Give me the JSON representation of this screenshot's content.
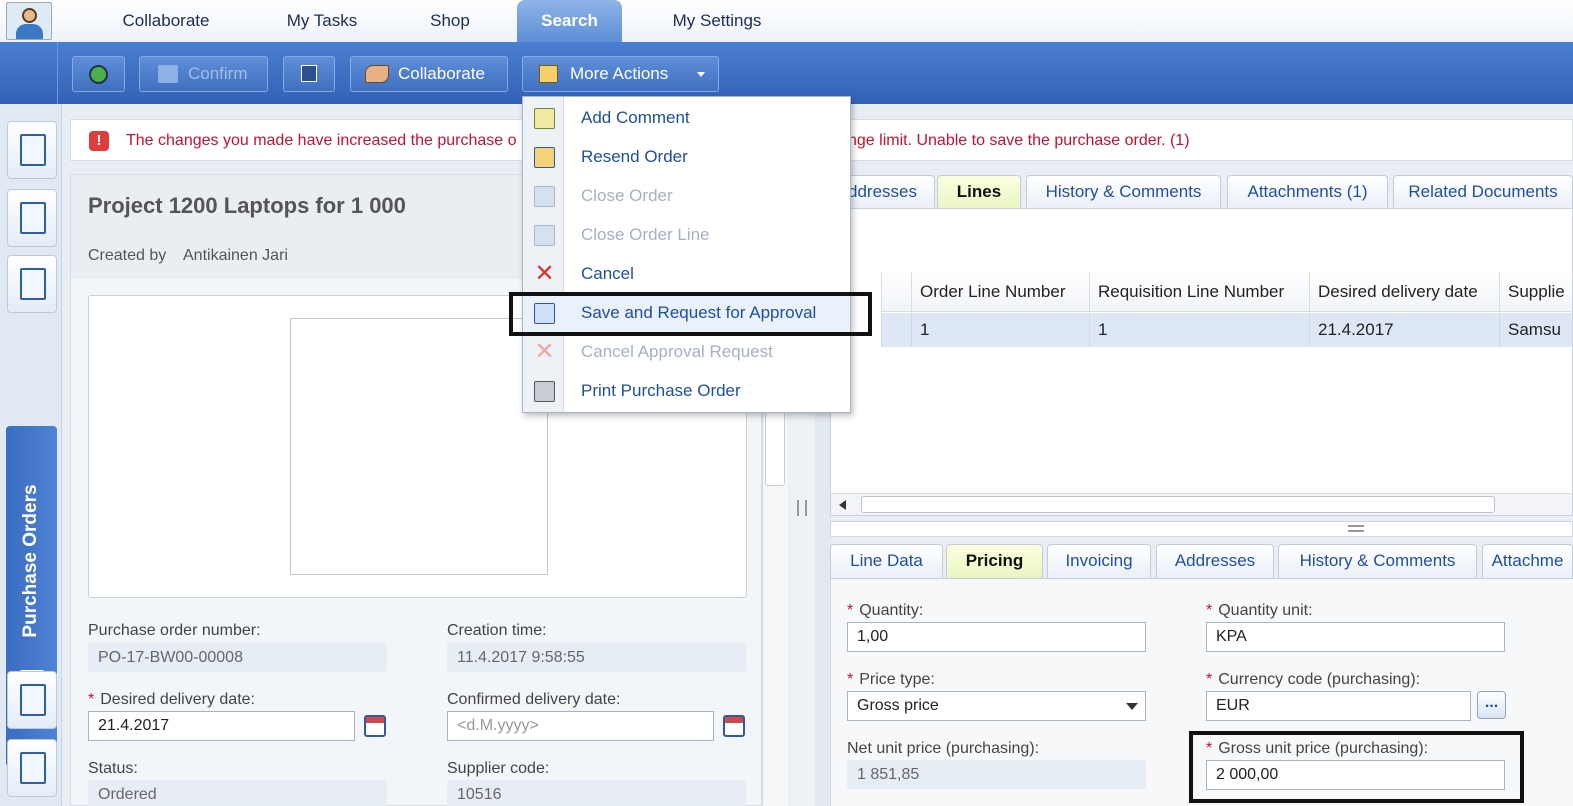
{
  "top_nav": {
    "tabs": [
      {
        "label": "Collaborate",
        "active": false
      },
      {
        "label": "My Tasks",
        "active": false
      },
      {
        "label": "Shop",
        "active": false
      },
      {
        "label": "Search",
        "active": true
      },
      {
        "label": "My Settings",
        "active": false
      }
    ]
  },
  "toolbar": {
    "confirm_label": "Confirm",
    "collaborate_label": "Collaborate",
    "more_actions_label": "More Actions"
  },
  "left_rail": {
    "purchase_orders_label": "Purchase Orders"
  },
  "error": {
    "text_left": "The changes you made have increased the purchase o",
    "text_right": "nge limit. Unable to save the purchase order. (1)"
  },
  "order": {
    "title": "Project 1200 Laptops for 1 000",
    "created_by_label": "Created by",
    "created_by_value": "Antikainen Jari",
    "fields": {
      "po_number_label": "Purchase order number:",
      "po_number_value": "PO-17-BW00-00008",
      "creation_time_label": "Creation time:",
      "creation_time_value": "11.4.2017 9:58:55",
      "desired_delivery_label": "Desired delivery date:",
      "desired_delivery_value": "21.4.2017",
      "confirmed_delivery_label": "Confirmed delivery date:",
      "confirmed_delivery_placeholder": "<d.M.yyyy>",
      "status_label": "Status:",
      "status_value": "Ordered",
      "supplier_code_label": "Supplier code:",
      "supplier_code_value": "10516"
    }
  },
  "detail_tabs": {
    "tabs": [
      {
        "label": "ddresses",
        "active": false
      },
      {
        "label": "Lines",
        "active": true
      },
      {
        "label": "History & Comments",
        "active": false
      },
      {
        "label": "Attachments (1)",
        "active": false
      },
      {
        "label": "Related Documents",
        "active": false
      }
    ]
  },
  "lines_grid": {
    "columns": [
      "Order Line Number",
      "Requisition Line Number",
      "Desired delivery date",
      "Supplie"
    ],
    "rows": [
      [
        "1",
        "1",
        "21.4.2017",
        "Samsu"
      ]
    ]
  },
  "line_tabs": {
    "tabs": [
      {
        "label": "Line Data",
        "active": false
      },
      {
        "label": "Pricing",
        "active": true
      },
      {
        "label": "Invoicing",
        "active": false
      },
      {
        "label": "Addresses",
        "active": false
      },
      {
        "label": "History & Comments",
        "active": false
      },
      {
        "label": "Attachme",
        "active": false
      }
    ]
  },
  "pricing": {
    "quantity_label": "Quantity:",
    "quantity_value": "1,00",
    "quantity_unit_label": "Quantity unit:",
    "quantity_unit_value": "KPA",
    "price_type_label": "Price type:",
    "price_type_value": "Gross price",
    "currency_label": "Currency code (purchasing):",
    "currency_value": "EUR",
    "ellipsis_label": "...",
    "net_unit_price_label": "Net unit price (purchasing):",
    "net_unit_price_value": "1 851,85",
    "gross_unit_price_label": "Gross unit price (purchasing):",
    "gross_unit_price_value": "2 000,00"
  },
  "more_actions_menu": {
    "items": [
      {
        "label": "Add Comment",
        "enabled": true,
        "icon": "comment-icon"
      },
      {
        "label": "Resend Order",
        "enabled": true,
        "icon": "resend-icon"
      },
      {
        "label": "Close Order",
        "enabled": false,
        "icon": "close-order-icon"
      },
      {
        "label": "Close Order Line",
        "enabled": false,
        "icon": "close-line-icon"
      },
      {
        "label": "Cancel",
        "enabled": true,
        "icon": "cancel-x-icon"
      },
      {
        "label": "Save and Request for Approval",
        "enabled": true,
        "icon": "approval-icon"
      },
      {
        "label": "Cancel Approval Request",
        "enabled": false,
        "icon": "cancel-approval-icon"
      },
      {
        "label": "Print Purchase Order",
        "enabled": true,
        "icon": "printer-icon"
      }
    ]
  },
  "colors": {
    "toolbar_blue": "#3a6cc4",
    "link_blue": "#1d4f9e",
    "error_red": "#c8102e",
    "active_tab_yellow": "#eaf5c2"
  }
}
